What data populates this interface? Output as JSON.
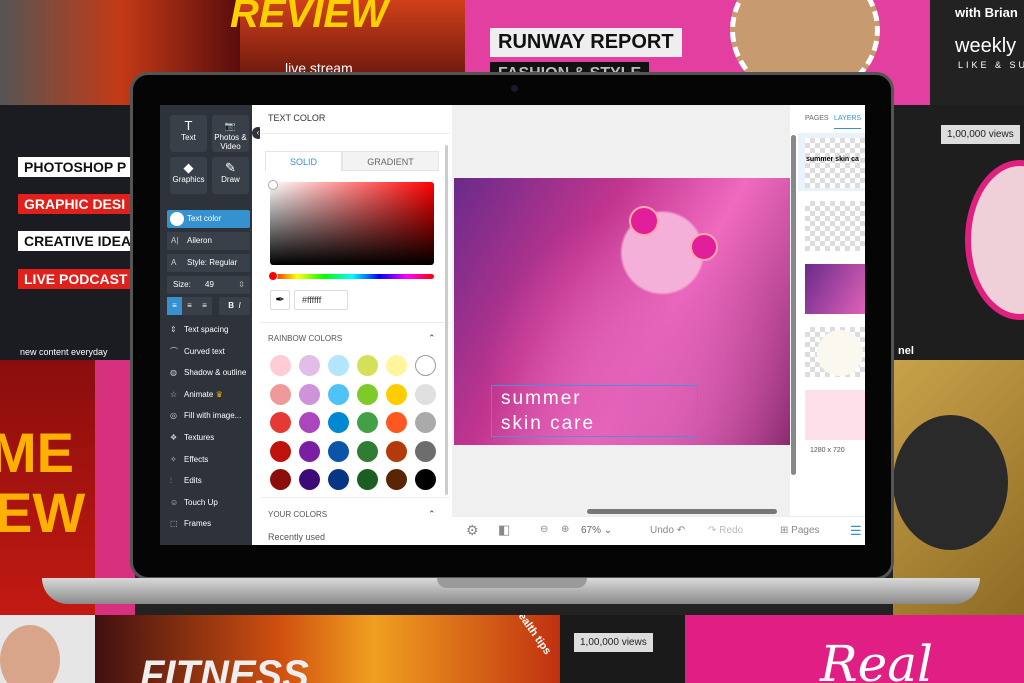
{
  "background": {
    "tiles": [
      "REVIEW",
      "live stream",
      "fashion",
      "RUNWAY REPORT",
      "FASHION & STYLE",
      "with Brian",
      "weekly",
      "LIKE & SUBSCRIBE",
      "PHOTOSHOP P",
      "GRAPHIC DESI",
      "CREATIVE IDEA",
      "LIVE PODCAST",
      "new content everyday",
      "1,00,000 views",
      "health tips",
      "FITNESS",
      "1,00,000 views",
      "Real",
      "ME",
      "EW",
      "nel"
    ]
  },
  "sidebar": {
    "tools": [
      {
        "label": "Text",
        "icon": "T"
      },
      {
        "label": "Photos & Video",
        "icon": "📷"
      },
      {
        "label": "Graphics",
        "icon": "◆"
      },
      {
        "label": "Draw",
        "icon": "✎"
      }
    ],
    "text_color": "Text color",
    "font": "Aileron",
    "style": "Style: Regular",
    "size_label": "Size:",
    "size_value": "49",
    "menu": [
      {
        "label": "Text spacing",
        "icon": "⇕"
      },
      {
        "label": "Curved text",
        "icon": "⌒"
      },
      {
        "label": "Shadow & outline",
        "icon": "◍"
      },
      {
        "label": "Animate",
        "icon": "☆"
      },
      {
        "label": "Fill with image...",
        "icon": "◎"
      },
      {
        "label": "Textures",
        "icon": "❖"
      },
      {
        "label": "Effects",
        "icon": "✧"
      },
      {
        "label": "Edits",
        "icon": "⫶"
      },
      {
        "label": "Touch Up",
        "icon": "☺"
      },
      {
        "label": "Frames",
        "icon": "⬚"
      }
    ]
  },
  "panel": {
    "title": "TEXT COLOR",
    "tabs": [
      "SOLID",
      "GRADIENT"
    ],
    "hex": "#ffffff",
    "rainbow_title": "RAINBOW COLORS",
    "swatches": [
      "#ffccd5",
      "#e1bee7",
      "#b3e5fc",
      "#d4e157",
      "#fff59d",
      "#ffffff",
      "#ef9a9a",
      "#ce93d8",
      "#4fc3f7",
      "#7ccb2a",
      "#ffcc00",
      "#e0e0e0",
      "#e53935",
      "#ab47bc",
      "#0288d1",
      "#43a047",
      "#ff5722",
      "#aaaaaa",
      "#c0120c",
      "#7b1fa2",
      "#0a55a8",
      "#2e7d32",
      "#b23a0b",
      "#6d6d6d",
      "#8b0e0a",
      "#3d0b75",
      "#083584",
      "#1b5e20",
      "#5a2504",
      "#000000"
    ],
    "your_colors": "YOUR COLORS",
    "recently_used": "Recently used"
  },
  "canvas": {
    "line1": "summer",
    "line2": "skin care"
  },
  "toolbar": {
    "zoom": "67%",
    "undo": "Undo",
    "redo": "Redo",
    "pages": "Pages"
  },
  "right": {
    "tabs": [
      "PAGES",
      "LAYERS"
    ],
    "layer_text": "summer skin ca",
    "size": "1280 x 720"
  }
}
